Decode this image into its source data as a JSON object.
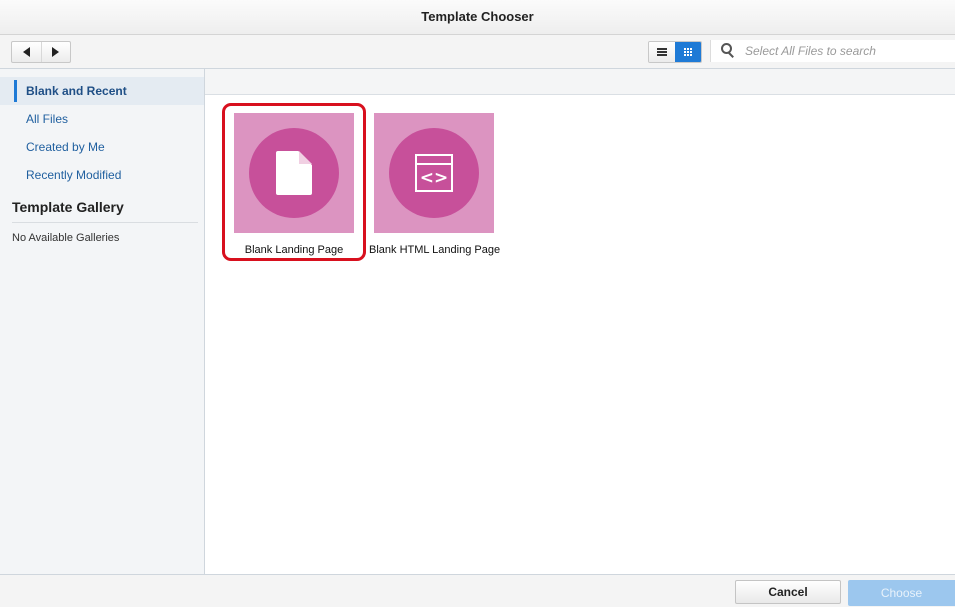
{
  "window": {
    "title": "Template Chooser"
  },
  "toolbar": {
    "back_icon": "triangle-left-icon",
    "forward_icon": "triangle-right-icon",
    "list_view_icon": "list-view-icon",
    "grid_view_icon": "grid-view-icon",
    "active_view": "grid",
    "search": {
      "placeholder": "Select All Files to search",
      "value": "",
      "icon": "search-icon"
    }
  },
  "sidebar": {
    "items": [
      {
        "label": "Blank and Recent",
        "selected": true
      },
      {
        "label": "All Files",
        "selected": false
      },
      {
        "label": "Created by Me",
        "selected": false
      },
      {
        "label": "Recently Modified",
        "selected": false
      }
    ],
    "gallery": {
      "heading": "Template Gallery",
      "empty_text": "No Available Galleries"
    }
  },
  "templates": [
    {
      "label": "Blank Landing Page",
      "icon": "document-icon",
      "highlighted": true
    },
    {
      "label": "Blank HTML Landing Page",
      "icon": "html-code-icon",
      "highlighted": false
    }
  ],
  "footer": {
    "cancel_label": "Cancel",
    "choose_label": "Choose",
    "choose_enabled": false
  },
  "colors": {
    "accent": "#1e7ad6",
    "tile_background": "#dc94c1",
    "tile_circle": "#c7509a",
    "highlight": "#d8101e",
    "choose_disabled": "#9cc7ee"
  }
}
